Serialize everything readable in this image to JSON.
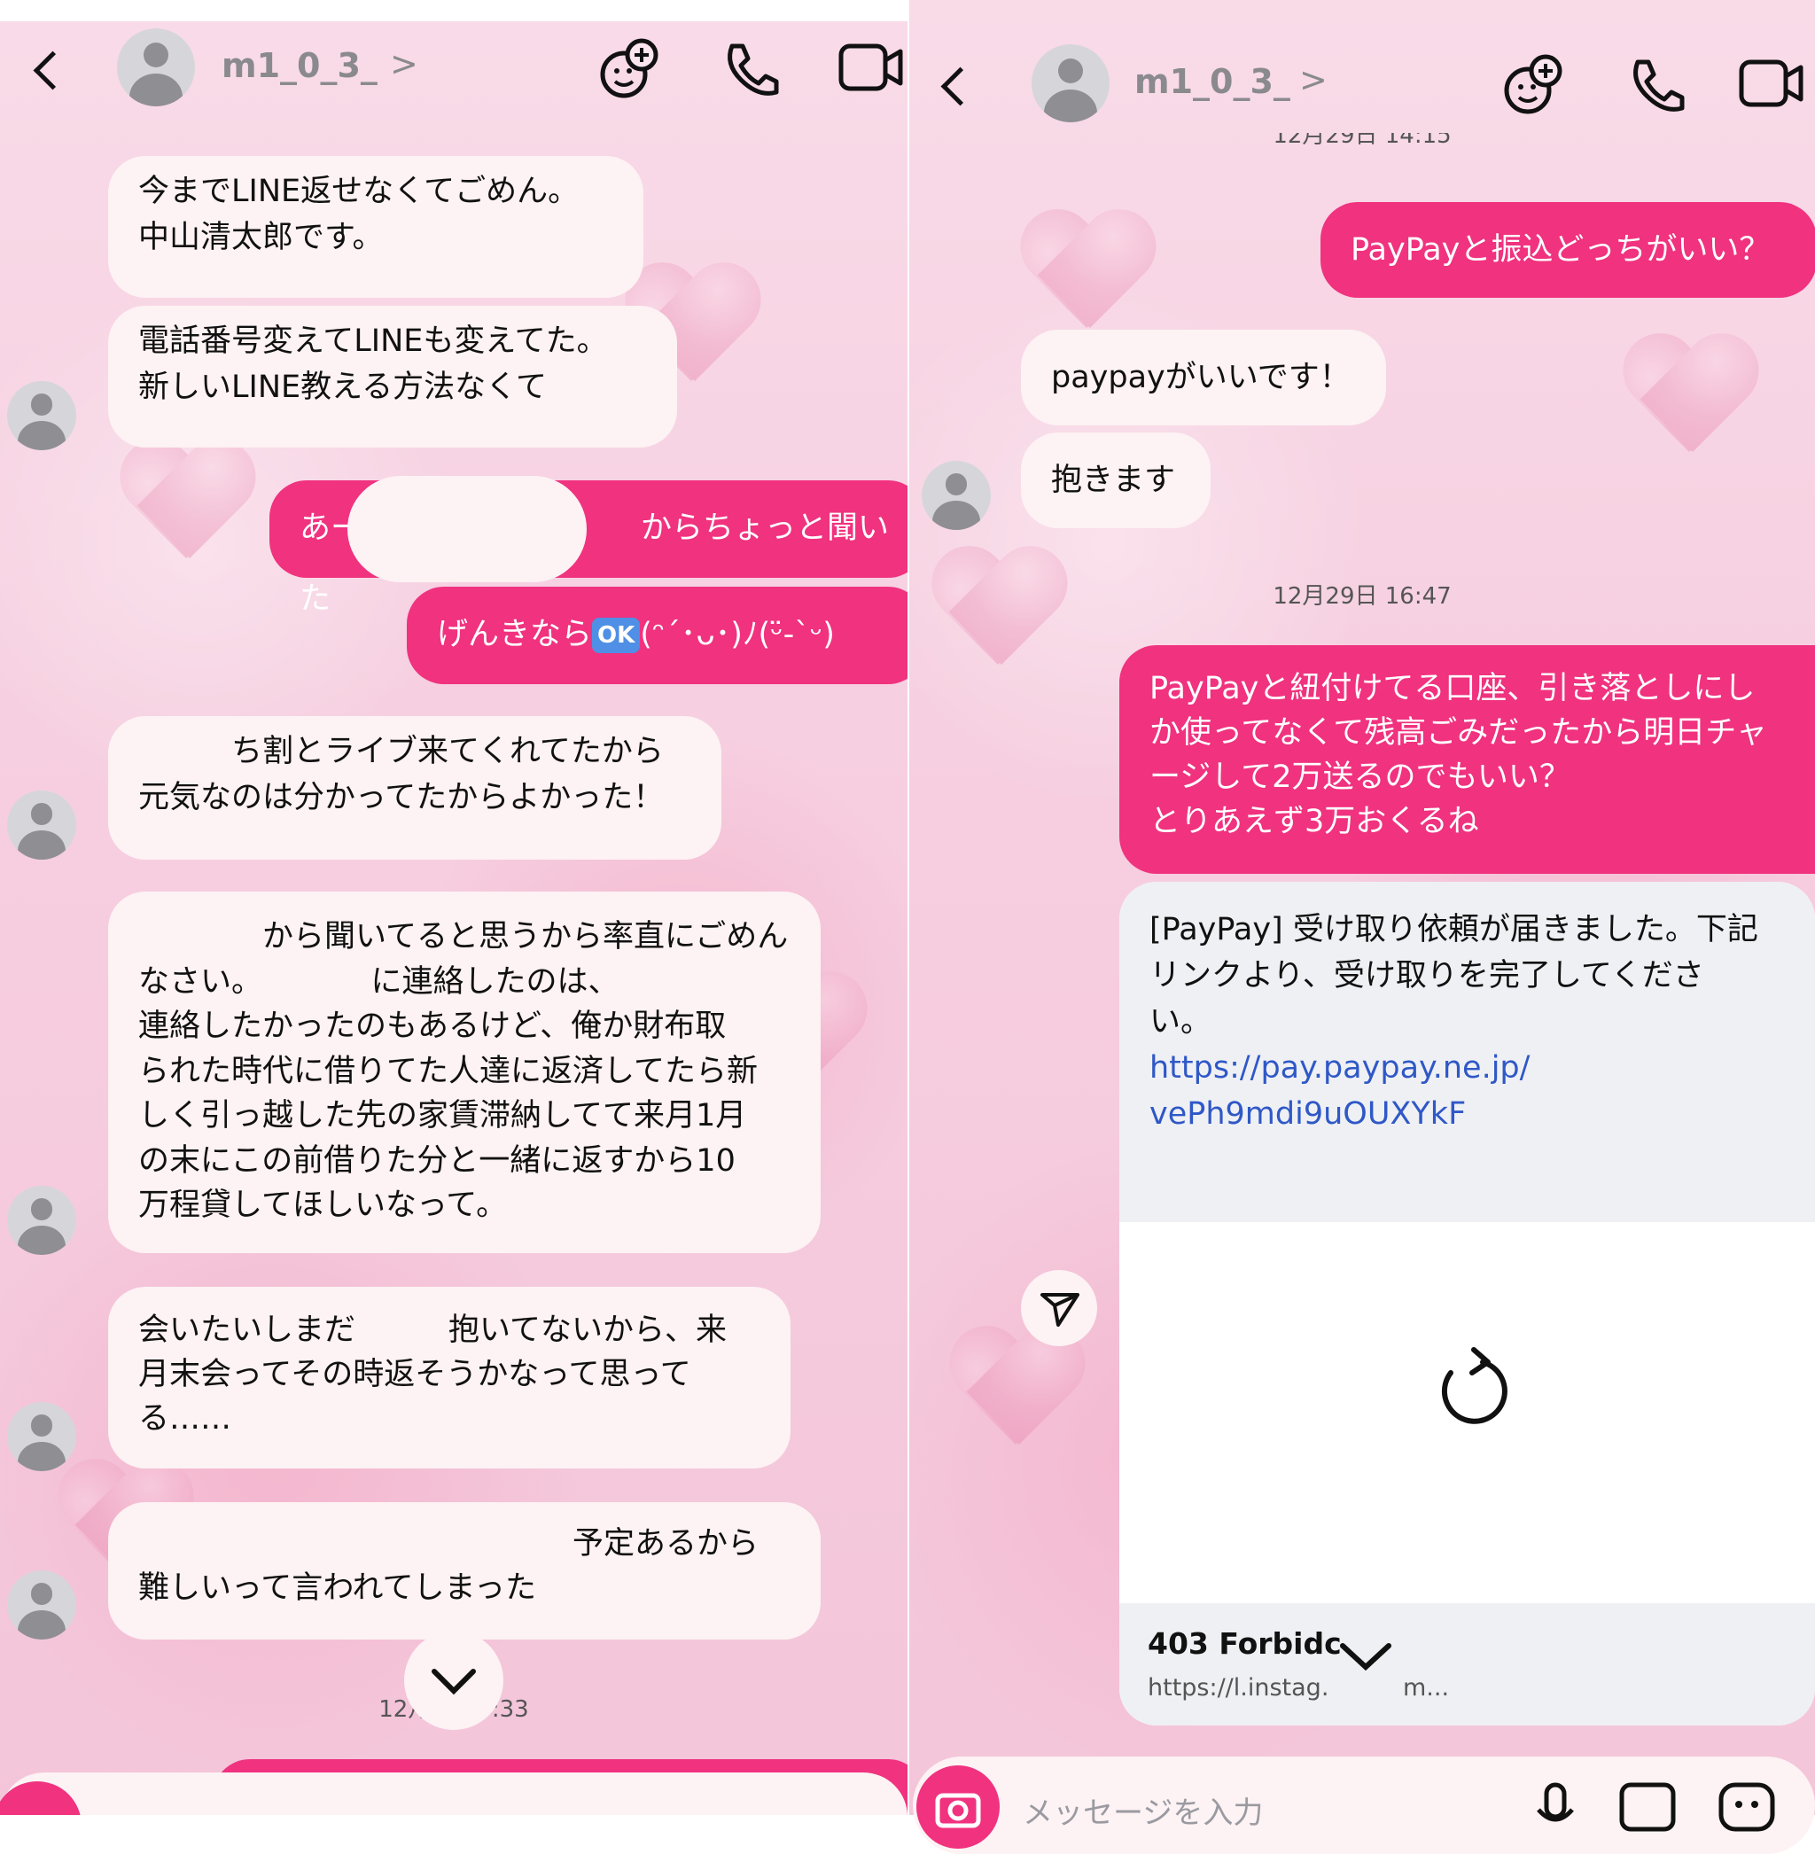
{
  "left": {
    "header": {
      "username": "m1_0_3_",
      "chevron": ">",
      "icons": [
        "back-icon",
        "avatar",
        "sticker-plus-icon",
        "phone-icon",
        "video-icon"
      ]
    },
    "messages": [
      {
        "dir": "in",
        "text": "今までLINE返せなくてごめん。\n中山清太郎です。"
      },
      {
        "dir": "in",
        "text": "電話番号変えてLINEも変えてた。\n新しいLINE教える方法なくて"
      },
      {
        "dir": "out",
        "text": "あー　　　　　　　　　からちょっと聞いた"
      },
      {
        "dir": "out",
        "text_pre": "げんきなら",
        "badge": "OK",
        "text_post": "(ᵔ´･ᴗ･)ﾉ(ᵕ̈-`ᵕ)"
      },
      {
        "dir": "in",
        "text": "　　　ち割とライブ来てくれてたから\n元気なのは分かってたからよかった！"
      },
      {
        "dir": "in",
        "text": "　　　　から聞いてると思うから率直にごめん\nなさい。　　　　に連絡したのは、\n連絡したかったのもあるけど、俺か財布取\nられた時代に借りてた人達に返済してたら新\nしく引っ越した先の家賃滞納してて来月1月\nの末にこの前借りた分と一緒に返すから10\n万程貸してほしいなって。"
      },
      {
        "dir": "in",
        "text": "会いたいしまだ　　　抱いてないから、来\n月末会ってその時返そうかなって思って\nる……"
      },
      {
        "dir": "in",
        "text": "　　　　　　　　　　　　　　予定あるから\n難しいって言われてしまった"
      }
    ],
    "timestamp": "12月　　3:33"
  },
  "right": {
    "header": {
      "username": "m1_0_3_",
      "chevron": ">",
      "icons": [
        "back-icon",
        "avatar",
        "sticker-plus-icon",
        "phone-icon",
        "video-icon"
      ]
    },
    "top_timestamp_partial": "12月29日 14:15",
    "messages": [
      {
        "dir": "out",
        "text": "PayPayと振込どっちがいい？"
      },
      {
        "dir": "in",
        "text": "paypayがいいです！"
      },
      {
        "dir": "in",
        "text": "抱きます"
      },
      {
        "dir": "out",
        "text": "PayPayと紐付けてる口座、引き落としにし\nか使ってなくて残高ごみだったから明日チャ\nージして2万送るのでもいい？\nとりあえず3万おくるね"
      }
    ],
    "timestamp": "12月29日 16:47",
    "link_card": {
      "text": "[PayPay] 受け取り依頼が届きました。下記\nリンクより、受け取りを完了してくださ\nい。",
      "url": "https://pay.paypay.ne.jp/\nvePh9mdi9uOUXYkF",
      "preview_title": "403 Forbidc",
      "preview_host": "https://l.instag.",
      "preview_host_tail": "m..."
    },
    "composer": {
      "placeholder": "メッセージを入力"
    }
  },
  "colors": {
    "outgoing": "#f0327f",
    "incoming": "#fdf2f4",
    "link": "#2f58c7",
    "header_text": "#8a8a8e"
  }
}
